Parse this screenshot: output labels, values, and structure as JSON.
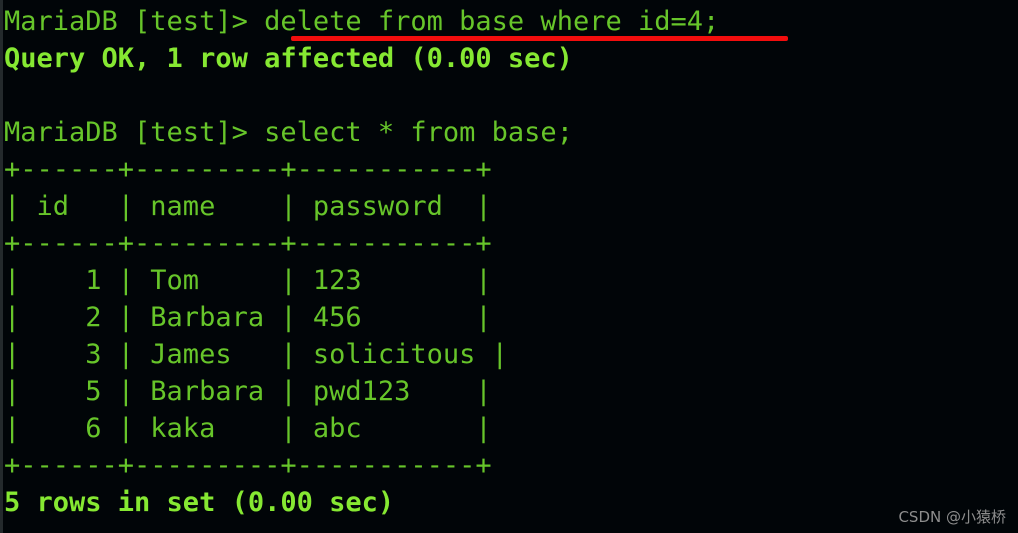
{
  "terminal": {
    "background_color": "#010508",
    "foreground_color": "#6fd02a",
    "bold_color": "#86e832",
    "annotation_color": "#f20d0d",
    "prompt": "MariaDB [test]> ",
    "lines": [
      {
        "id": "cmd-delete",
        "kind": "prompt-command",
        "prompt": "MariaDB [test]> ",
        "command": "delete from base where id=4;",
        "text": "MariaDB [test]> delete from base where id=4;"
      },
      {
        "id": "result-delete",
        "kind": "result",
        "bold": true,
        "text": "Query OK, 1 row affected (0.00 sec)"
      },
      {
        "id": "blank-1",
        "kind": "blank",
        "text": " "
      },
      {
        "id": "cmd-select",
        "kind": "prompt-command",
        "prompt": "MariaDB [test]> ",
        "command": "select * from base;",
        "text": "MariaDB [test]> select * from base;"
      },
      {
        "id": "table-top-border",
        "kind": "table-border",
        "text": "+------+---------+-----------+"
      },
      {
        "id": "table-header",
        "kind": "table-header",
        "text": "| id   | name    | password  |"
      },
      {
        "id": "table-header-border",
        "kind": "table-border",
        "text": "+------+---------+-----------+"
      },
      {
        "id": "table-row-1",
        "kind": "table-row",
        "text": "|    1 | Tom     | 123       |"
      },
      {
        "id": "table-row-2",
        "kind": "table-row",
        "text": "|    2 | Barbara | 456       |"
      },
      {
        "id": "table-row-3",
        "kind": "table-row",
        "text": "|    3 | James   | solicitous |"
      },
      {
        "id": "table-row-4",
        "kind": "table-row",
        "text": "|    5 | Barbara | pwd123    |"
      },
      {
        "id": "table-row-5",
        "kind": "table-row",
        "text": "|    6 | kaka    | abc       |"
      },
      {
        "id": "table-bottom-border",
        "kind": "table-border",
        "text": "+------+---------+-----------+"
      },
      {
        "id": "result-select",
        "kind": "result",
        "bold": true,
        "text": "5 rows in set (0.00 sec)"
      }
    ],
    "result_table": {
      "columns": [
        "id",
        "name",
        "password"
      ],
      "rows": [
        [
          "1",
          "Tom",
          "123"
        ],
        [
          "2",
          "Barbara",
          "456"
        ],
        [
          "3",
          "James",
          "solicitous"
        ],
        [
          "5",
          "Barbara",
          "pwd123"
        ],
        [
          "6",
          "kaka",
          "abc"
        ]
      ],
      "row_count_text": "5 rows in set (0.00 sec)"
    },
    "annotation": {
      "target_text": "delete from base where id=4;",
      "color": "#f20d0d"
    }
  },
  "watermark": {
    "text": "CSDN @小猿桥"
  }
}
